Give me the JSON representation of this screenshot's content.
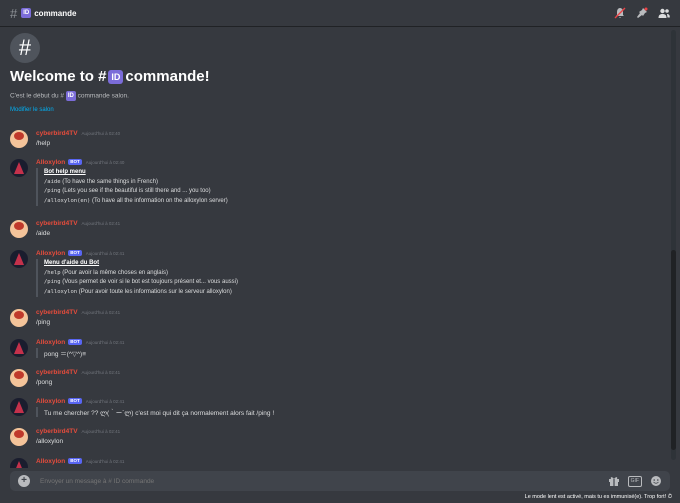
{
  "header": {
    "channel_emoji": "ID",
    "channel_name": "commande"
  },
  "welcome": {
    "title_prefix": "Welcome to #",
    "title_emoji": "ID",
    "title_suffix": "commande!",
    "sub_prefix": "C'est le début du #",
    "sub_emoji": "ID",
    "sub_suffix": "commande salon.",
    "edit_link": "Modifier le salon"
  },
  "messages": [
    {
      "author": "cyberbird4TV",
      "type": "user",
      "time": "Aujourd'hui à 02:40",
      "text": "/help"
    },
    {
      "author": "Alloxylon",
      "type": "bot",
      "time": "Aujourd'hui à 02:40",
      "embed": {
        "title": "Bot help menu",
        "lines": [
          {
            "cmd": "/aide",
            "desc": " (To have the same things in French)"
          },
          {
            "cmd": "/ping",
            "desc": " (Lets you see if the beautiful is still there and ... you too)"
          },
          {
            "cmd": "/alloxylon(en)",
            "desc": " (To have all the information on the alloxylon server)"
          }
        ]
      }
    },
    {
      "author": "cyberbird4TV",
      "type": "user",
      "time": "Aujourd'hui à 02:41",
      "text": "/aide"
    },
    {
      "author": "Alloxylon",
      "type": "bot",
      "time": "Aujourd'hui à 02:41",
      "embed": {
        "title": "Menu d'aide du Bot",
        "lines": [
          {
            "cmd": "/help",
            "desc": " (Pour avoir la même choses en anglais)"
          },
          {
            "cmd": "/ping",
            "desc": " (Vous permet de voir si le bot est toujours présent et... vous aussi)"
          },
          {
            "cmd": "/alloxylon",
            "desc": " (Pour avoir toute les informations sur le serveur alloxylon)"
          }
        ]
      }
    },
    {
      "author": "cyberbird4TV",
      "type": "user",
      "time": "Aujourd'hui à 02:41",
      "text": "/ping"
    },
    {
      "author": "Alloxylon",
      "type": "bot",
      "time": "Aujourd'hui à 02:41",
      "quote": "pong ＝(^▽^)≡"
    },
    {
      "author": "cyberbird4TV",
      "type": "user",
      "time": "Aujourd'hui à 02:41",
      "text": "/pong"
    },
    {
      "author": "Alloxylon",
      "type": "bot",
      "time": "Aujourd'hui à 02:41",
      "quote": "Tu me chercher ?? ლ(｀ー´ლ) c'est moi qui dit ça normalement alors fait /ping !"
    },
    {
      "author": "cyberbird4TV",
      "type": "user",
      "time": "Aujourd'hui à 02:41",
      "text": "/alloxylon"
    },
    {
      "author": "Alloxylon",
      "type": "bot",
      "time": "Aujourd'hui à 02:41",
      "text": ""
    }
  ],
  "bot_tag": "BOT",
  "composer": {
    "placeholder": "Envoyer un message à # ID commande"
  },
  "status_bar": "Le mode lent est activé, mais tu es immunisé(e). Trop fort!"
}
